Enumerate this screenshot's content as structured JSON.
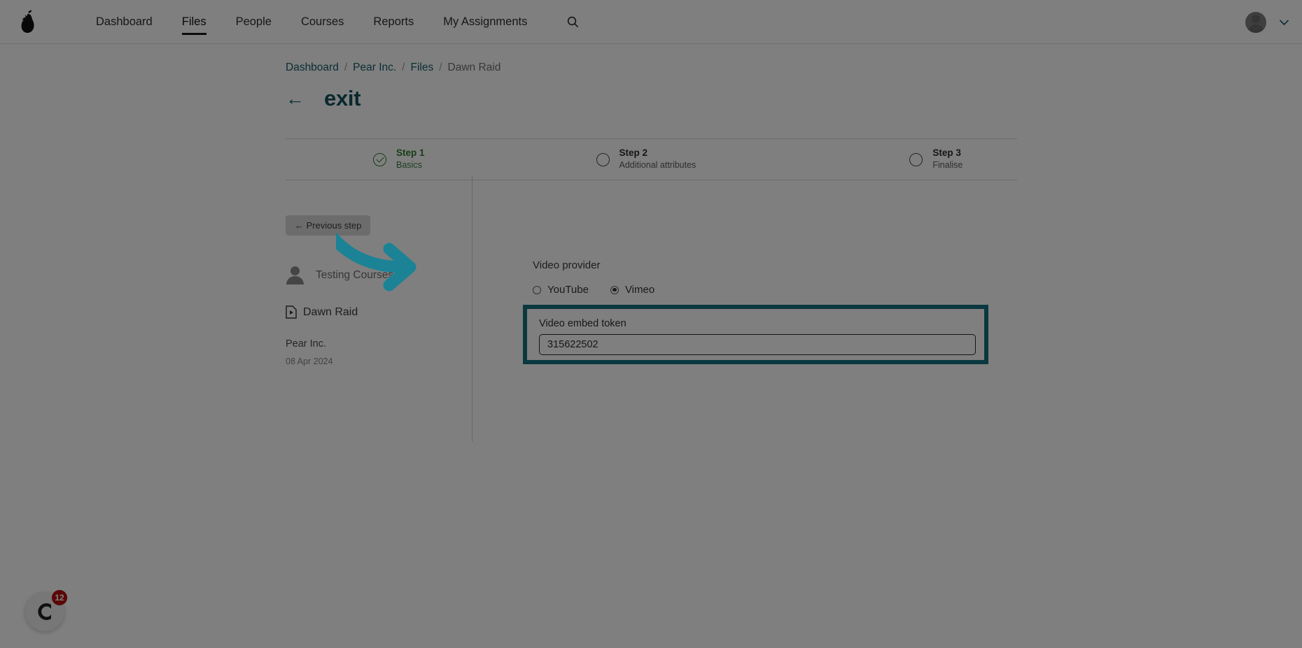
{
  "topnav": {
    "logo_icon": "pear-logo-icon",
    "links": [
      {
        "label": "Dashboard",
        "active": false
      },
      {
        "label": "Files",
        "active": true
      },
      {
        "label": "People",
        "active": false
      },
      {
        "label": "Courses",
        "active": false
      },
      {
        "label": "Reports",
        "active": false
      },
      {
        "label": "My Assignments",
        "active": false
      }
    ],
    "search_icon": "search-icon",
    "avatar_icon": "user-avatar-icon",
    "chevron_icon": "chevron-down-icon"
  },
  "breadcrumb": {
    "items": [
      "Dashboard",
      "Pear Inc.",
      "Files",
      "Dawn Raid"
    ],
    "separator": "/"
  },
  "header": {
    "back_arrow": "←",
    "title": "exit"
  },
  "stepper": {
    "steps": [
      {
        "number": "Step 1",
        "name": "Basics",
        "state": "done"
      },
      {
        "number": "Step 2",
        "name": "Additional attributes",
        "state": "pending"
      },
      {
        "number": "Step 3",
        "name": "Finalise",
        "state": "pending"
      }
    ]
  },
  "leftpane": {
    "previous_step_label": "← Previous step",
    "owner": "Testing Courses",
    "file_name": "Dawn Raid",
    "organisation": "Pear Inc.",
    "date": "08 Apr 2024"
  },
  "form": {
    "video_provider_label": "Video provider",
    "providers": [
      {
        "label": "YouTube",
        "selected": false
      },
      {
        "label": "Vimeo",
        "selected": true
      }
    ],
    "token_label": "Video embed token",
    "token_value": "315622502",
    "token_placeholder": ""
  },
  "chat": {
    "badge_count": "12",
    "icon": "chat-widget-icon"
  },
  "colors": {
    "accent_teal": "#15707f",
    "arrow_teal": "#1b8395",
    "link_teal": "#175a66",
    "title_teal": "#12505c",
    "success_green": "#2e7d32",
    "badge_red": "#b50e0e",
    "overlay": "rgba(0,0,0,0.50)"
  }
}
